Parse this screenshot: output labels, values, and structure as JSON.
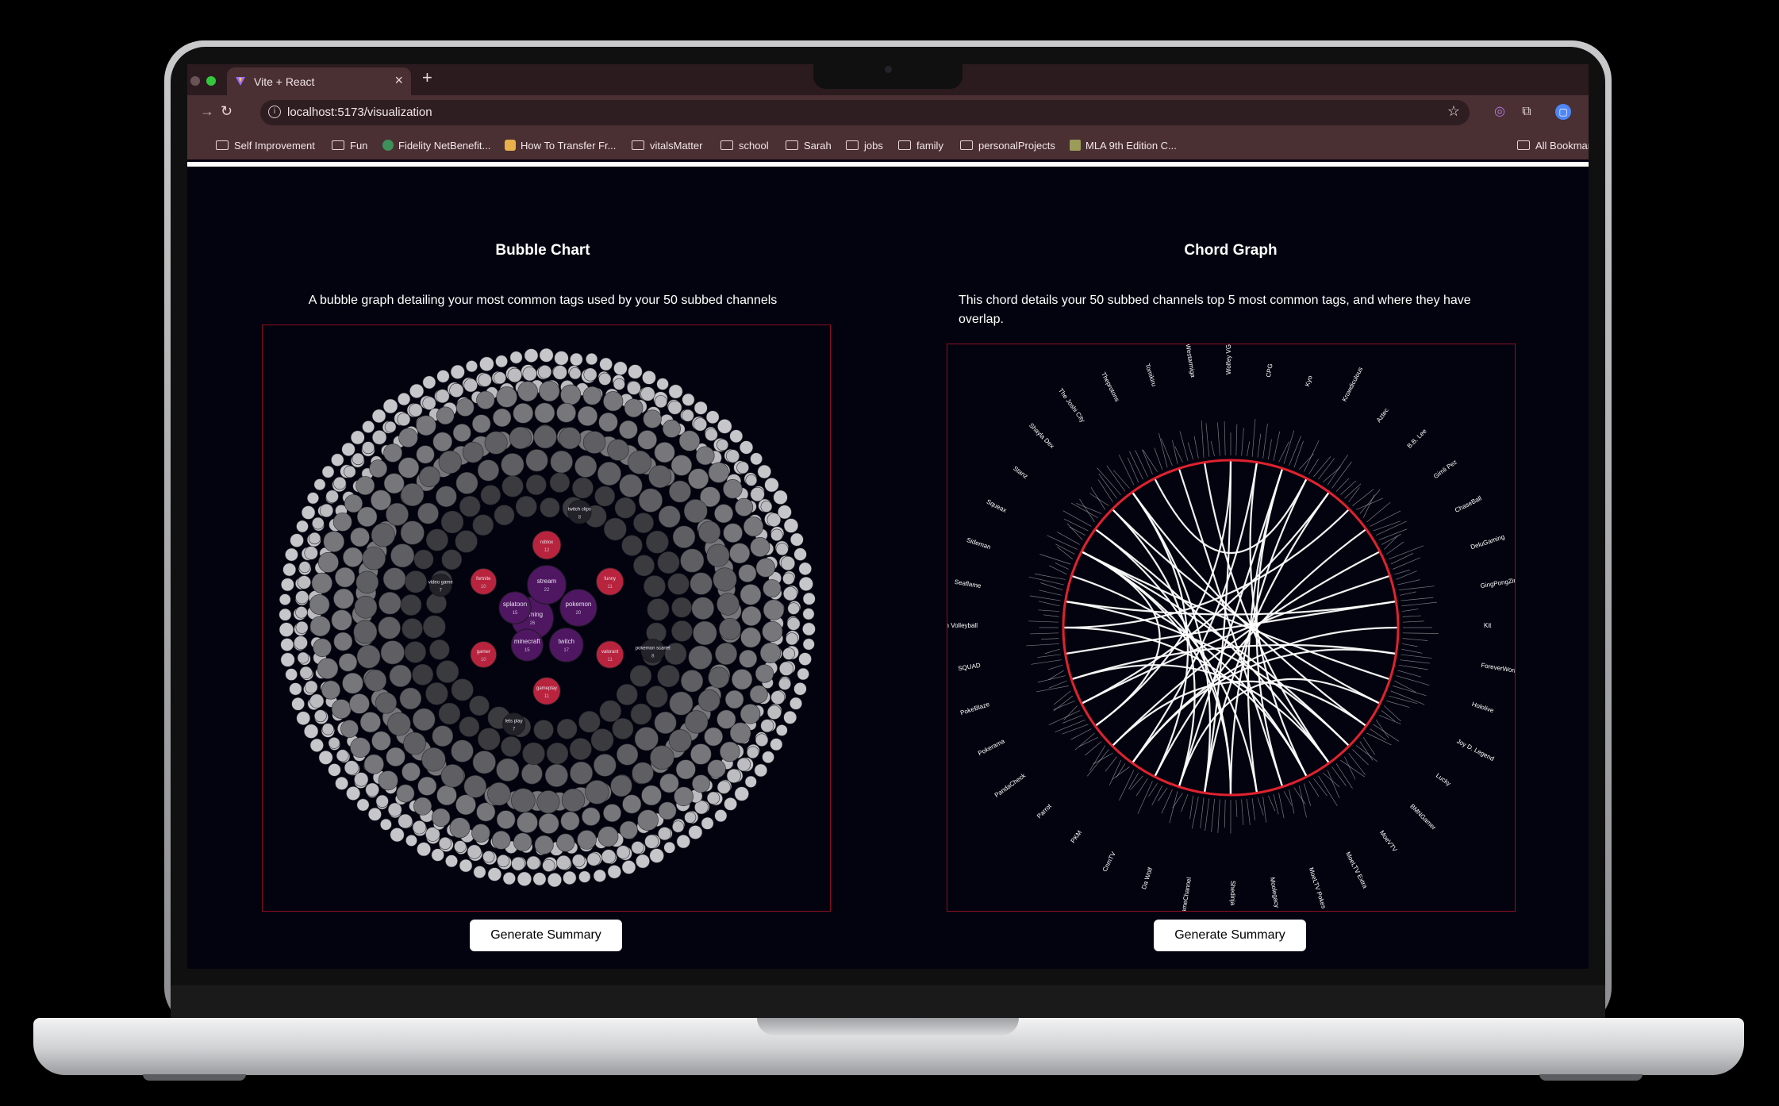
{
  "browser": {
    "tab_title": "Vite + React",
    "new_tab": "+",
    "close_tab": "×",
    "url": "localhost:5173/visualization",
    "bookmarks": [
      "Self Improvement",
      "Fun",
      "Fidelity NetBenefit...",
      "How To Transfer Fr...",
      "vitalsMatter",
      "school",
      "Sarah",
      "jobs",
      "family",
      "personalProjects",
      "MLA 9th Edition C..."
    ],
    "all_bookmarks": "All Bookmarks"
  },
  "page": {
    "bubble": {
      "title": "Bubble Chart",
      "description": "A bubble graph detailing your most common tags used by your 50 subbed channels",
      "button": "Generate Summary"
    },
    "chord": {
      "title": "Chord Graph",
      "description": "This chord details your 50 subbed channels top 5 most common tags, and where they have overlap.",
      "button": "Generate Summary"
    }
  },
  "colors": {
    "background": "#03030f",
    "chart_border": "#8b1020",
    "bubble_purple": "#4f1662",
    "bubble_red": "#b8243d",
    "chord_ring": "#e0222e"
  },
  "chart_data": [
    {
      "type": "bubble",
      "title": "Bubble Chart",
      "labeled_bubbles": [
        {
          "label": "gaming",
          "value": 26,
          "tier": "purple"
        },
        {
          "label": "stream",
          "value": 22,
          "tier": "purple"
        },
        {
          "label": "pokemon",
          "value": 20,
          "tier": "purple"
        },
        {
          "label": "twitch",
          "value": 17,
          "tier": "purple"
        },
        {
          "label": "minecraft",
          "value": 15,
          "tier": "purple"
        },
        {
          "label": "splatoon",
          "value": 15,
          "tier": "purple"
        },
        {
          "label": "roblox",
          "value": 12,
          "tier": "red"
        },
        {
          "label": "funny",
          "value": 11,
          "tier": "red"
        },
        {
          "label": "valorant",
          "value": 11,
          "tier": "red"
        },
        {
          "label": "gameplay",
          "value": 11,
          "tier": "red"
        },
        {
          "label": "gamer",
          "value": 10,
          "tier": "red"
        },
        {
          "label": "fortnite",
          "value": 10,
          "tier": "red"
        },
        {
          "label": "twitch clips",
          "value": 8,
          "tier": "dark"
        },
        {
          "label": "pokemon scarlet",
          "value": 8,
          "tier": "dark"
        },
        {
          "label": "lets play",
          "value": 7,
          "tier": "dark"
        },
        {
          "label": "video game",
          "value": 7,
          "tier": "dark"
        }
      ]
    },
    {
      "type": "chord",
      "title": "Chord Graph",
      "channels": [
        "Wolfey VGC",
        "CPG",
        "Kyo",
        "Krowdiculous",
        "Aztec",
        "B.B. Lee",
        "Gimli Pez",
        "ChaseBall",
        "DeluGaming",
        "GingPongZing",
        "Kit",
        "ForeverWorld Ow",
        "Hololive",
        "Joy D. Legend",
        "Lucky",
        "BMNGamer",
        "MoeVTV",
        "MoeLTV Extra",
        "MoeLTV Pokes",
        "Moolegacy",
        "Shedinja",
        "GameChannel",
        "Da Wolf",
        "CnmTV",
        "PKM",
        "Parrot",
        "PandaCheck",
        "Pokerama",
        "PokeBlaze",
        "SQUAD",
        "Ash Paren Volleyball",
        "Seaflame",
        "Sideman",
        "Squeax",
        "Stanz",
        "Shayla Dex",
        "The Joshi City",
        "Theprotons",
        "Tomikiru",
        "Westarmiga"
      ]
    }
  ]
}
